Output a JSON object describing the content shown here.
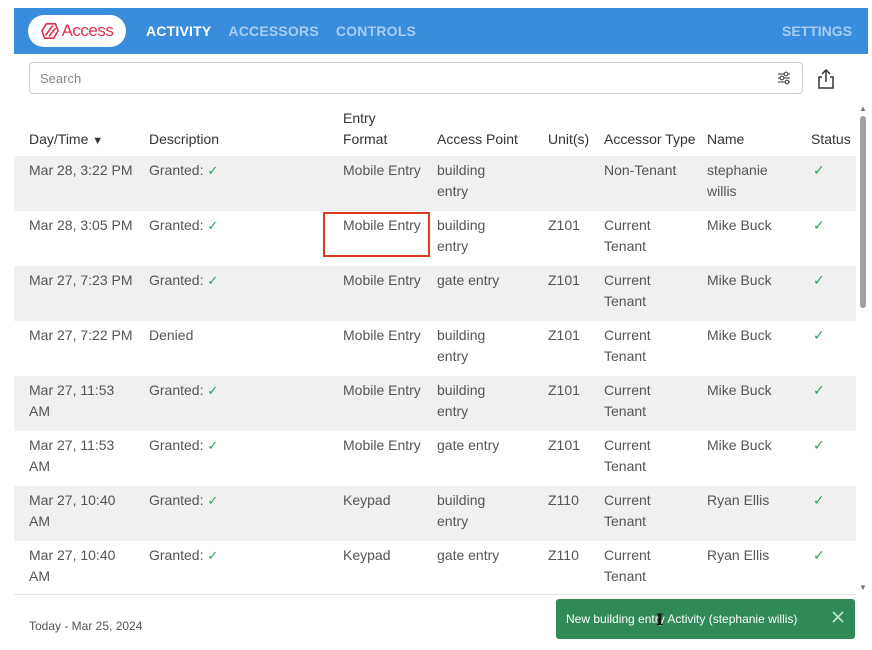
{
  "app": {
    "logo_text": "Access",
    "tabs": [
      {
        "label": "ACTIVITY",
        "active": true
      },
      {
        "label": "ACCESSORS",
        "active": false
      },
      {
        "label": "CONTROLS",
        "active": false
      }
    ],
    "settings_label": "SETTINGS",
    "colors": {
      "header": "#3a8ddc",
      "logo": "#e0314b",
      "success": "#2e9e5b",
      "toast": "#2f8a57",
      "highlight": "#e03a1e"
    }
  },
  "search": {
    "placeholder": "Search",
    "filter_icon": "sliders-icon",
    "share_icon": "share-icon"
  },
  "table": {
    "headers": {
      "datetime": "Day/Time",
      "sort_indicator": "▼",
      "description": "Description",
      "entry_format_1": "Entry",
      "entry_format_2": "Format",
      "access_point": "Access Point",
      "units": "Unit(s)",
      "accessor_type": "Accessor Type",
      "name": "Name",
      "status": "Status"
    },
    "rows": [
      {
        "date1": "Mar 28, 3:22 PM",
        "date2": "",
        "description": "Granted:",
        "desc_check": "✓",
        "entry_format": "Mobile Entry",
        "access1": "building",
        "access2": "entry",
        "unit": "",
        "type1": "Non-Tenant",
        "type2": "",
        "name1": "stephanie",
        "name2": "willis",
        "status": "✓"
      },
      {
        "date1": "Mar 28, 3:05 PM",
        "date2": "",
        "description": "Granted:",
        "desc_check": "✓",
        "entry_format": "Mobile Entry",
        "access1": "building",
        "access2": "entry",
        "unit": "Z101",
        "type1": "Current",
        "type2": "Tenant",
        "name1": "Mike Buck",
        "name2": "",
        "status": "✓"
      },
      {
        "date1": "Mar 27, 7:23 PM",
        "date2": "",
        "description": "Granted:",
        "desc_check": "✓",
        "entry_format": "Mobile Entry",
        "access1": "gate entry",
        "access2": "",
        "unit": "Z101",
        "type1": "Current",
        "type2": "Tenant",
        "name1": "Mike Buck",
        "name2": "",
        "status": "✓"
      },
      {
        "date1": "Mar 27, 7:22 PM",
        "date2": "",
        "description": "Denied",
        "desc_check": "",
        "entry_format": "Mobile Entry",
        "access1": "building",
        "access2": "entry",
        "unit": "Z101",
        "type1": "Current",
        "type2": "Tenant",
        "name1": "Mike Buck",
        "name2": "",
        "status": "✓"
      },
      {
        "date1": "Mar 27, 11:53",
        "date2": "AM",
        "description": "Granted:",
        "desc_check": "✓",
        "entry_format": "Mobile Entry",
        "access1": "building",
        "access2": "entry",
        "unit": "Z101",
        "type1": "Current",
        "type2": "Tenant",
        "name1": "Mike Buck",
        "name2": "",
        "status": "✓"
      },
      {
        "date1": "Mar 27, 11:53",
        "date2": "AM",
        "description": "Granted:",
        "desc_check": "✓",
        "entry_format": "Mobile Entry",
        "access1": "gate entry",
        "access2": "",
        "unit": "Z101",
        "type1": "Current",
        "type2": "Tenant",
        "name1": "Mike Buck",
        "name2": "",
        "status": "✓"
      },
      {
        "date1": "Mar 27, 10:40",
        "date2": "AM",
        "description": "Granted:",
        "desc_check": "✓",
        "entry_format": "Keypad",
        "access1": "building",
        "access2": "entry",
        "unit": "Z110",
        "type1": "Current",
        "type2": "Tenant",
        "name1": "Ryan Ellis",
        "name2": "",
        "status": "✓"
      },
      {
        "date1": "Mar 27, 10:40",
        "date2": "AM",
        "description": "Granted:",
        "desc_check": "✓",
        "entry_format": "Keypad",
        "access1": "gate entry",
        "access2": "",
        "unit": "Z110",
        "type1": "Current",
        "type2": "Tenant",
        "name1": "Ryan Ellis",
        "name2": "",
        "status": "✓"
      }
    ]
  },
  "footer": {
    "date_range": "Today - Mar 25, 2024"
  },
  "toast": {
    "message": "New building entry Activity (stephanie willis)",
    "close_icon": "close-icon"
  }
}
